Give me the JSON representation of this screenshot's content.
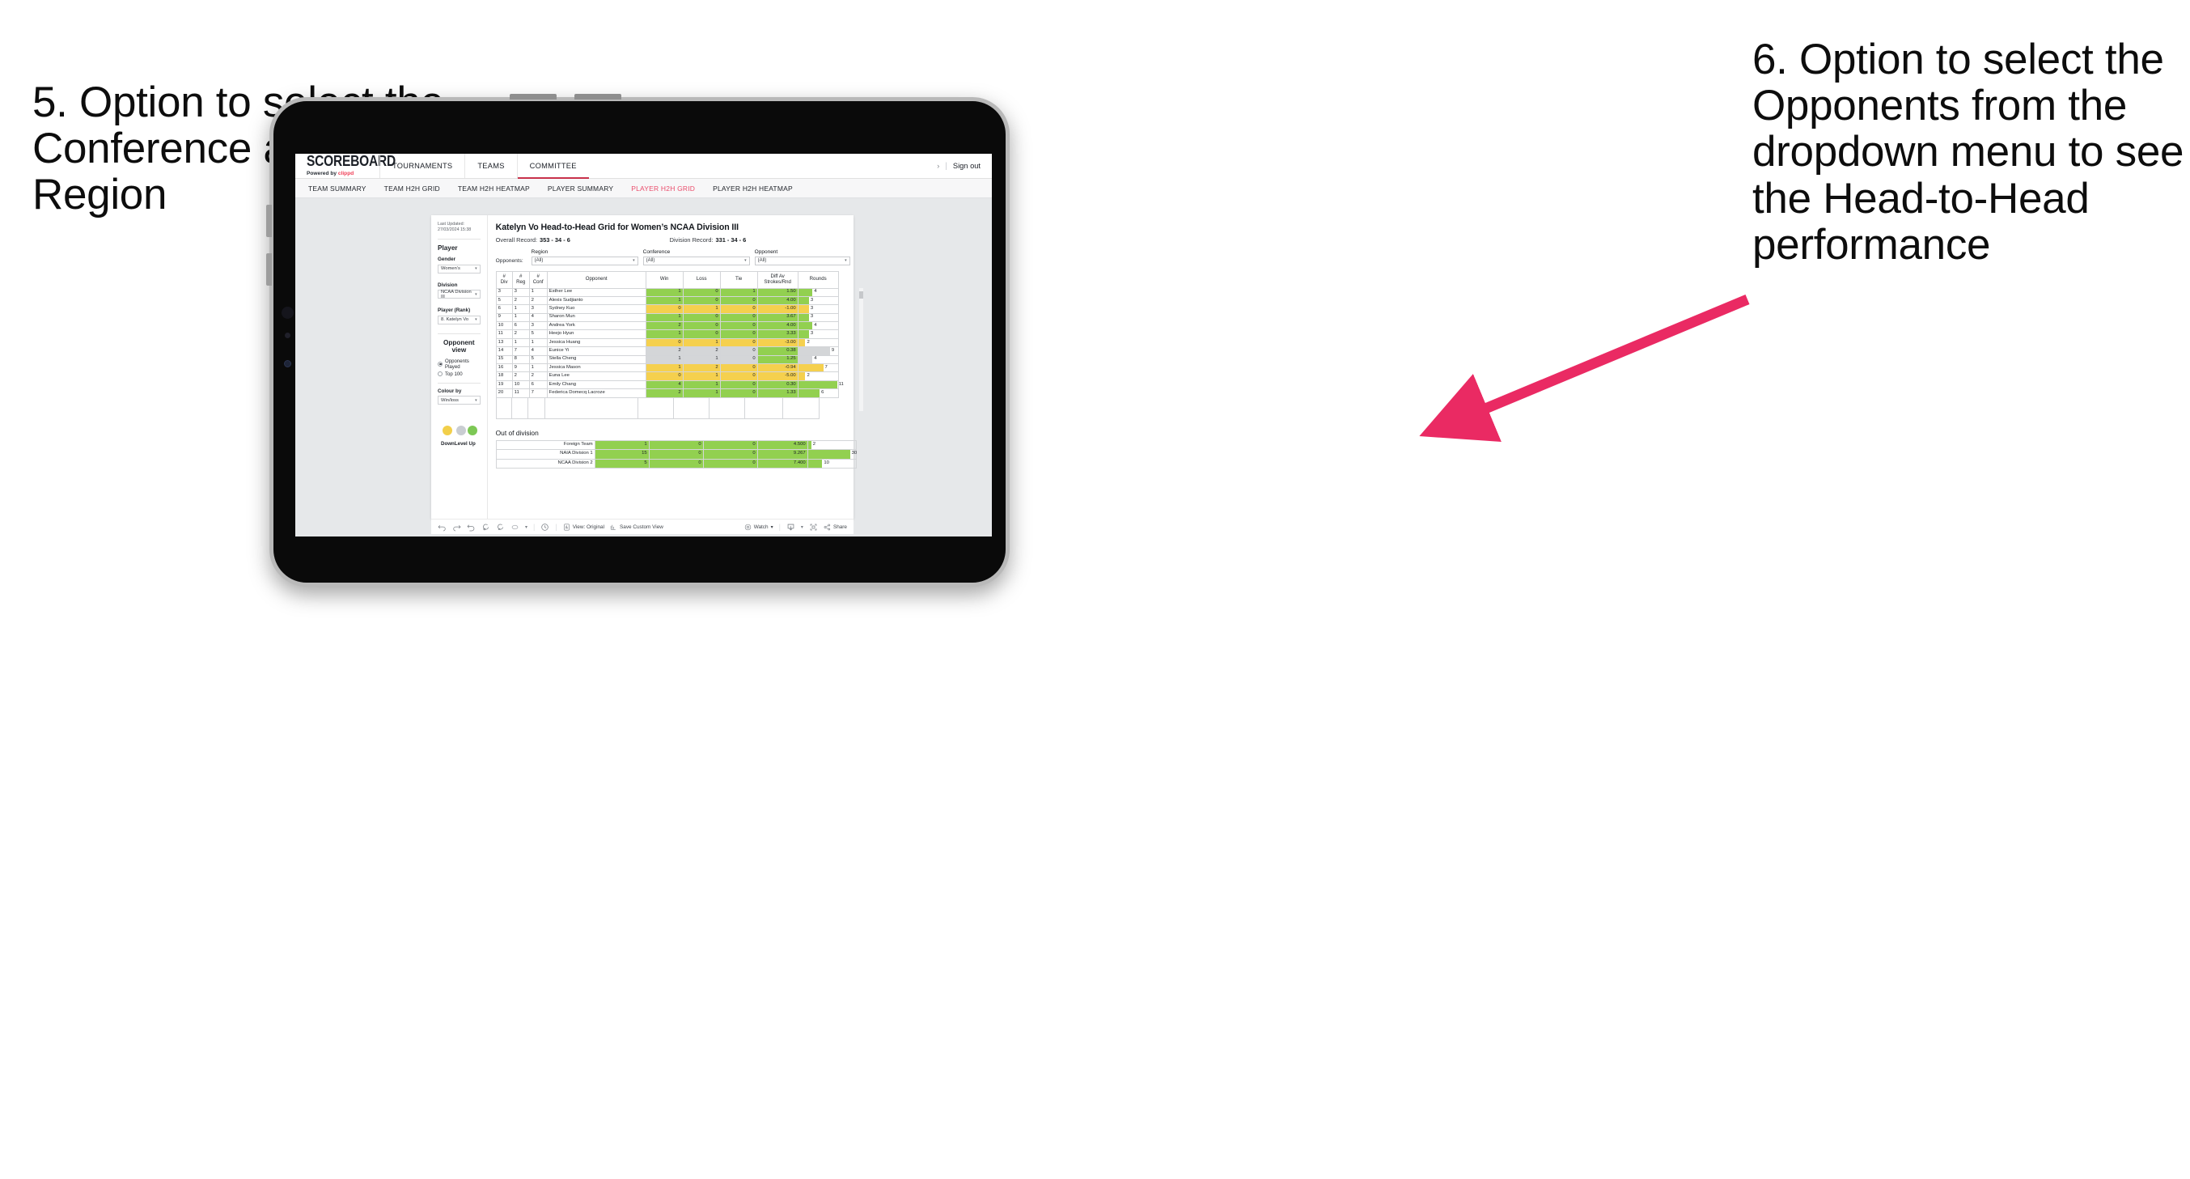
{
  "annotations": {
    "left": "5. Option to select the Conference and Region",
    "right": "6. Option to select the Opponents from the dropdown menu to see the Head-to-Head performance",
    "arrow_color": "#ea2a63"
  },
  "app": {
    "brand": {
      "title": "SCOREBOARD",
      "powered_prefix": "Powered by ",
      "powered_brand": "clippd"
    },
    "top_nav": [
      {
        "label": "TOURNAMENTS",
        "active": false
      },
      {
        "label": "TEAMS",
        "active": false
      },
      {
        "label": "COMMITTEE",
        "active": true
      }
    ],
    "header_right": {
      "chevron": "›",
      "divider": "|",
      "sign_out": "Sign out"
    },
    "sub_tabs": [
      {
        "label": "TEAM SUMMARY",
        "active": false
      },
      {
        "label": "TEAM H2H GRID",
        "active": false
      },
      {
        "label": "TEAM H2H HEATMAP",
        "active": false
      },
      {
        "label": "PLAYER SUMMARY",
        "active": false
      },
      {
        "label": "PLAYER H2H GRID",
        "active": true
      },
      {
        "label": "PLAYER H2H HEATMAP",
        "active": false
      }
    ]
  },
  "sidebar": {
    "last_updated": "Last Updated: 27/03/2024 15:38",
    "player_heading": "Player",
    "gender": {
      "label": "Gender",
      "value": "Women’s"
    },
    "division": {
      "label": "Division",
      "value": "NCAA Division III"
    },
    "player_rank": {
      "label": "Player (Rank)",
      "value": "8. Katelyn Vo"
    },
    "opponent_view": {
      "heading": "Opponent view",
      "options": [
        {
          "label": "Opponents Played",
          "selected": true
        },
        {
          "label": "Top 100",
          "selected": false
        }
      ]
    },
    "colour_by": {
      "label": "Colour by",
      "value": "Win/loss"
    },
    "legend": [
      {
        "caption": "Down",
        "color": "#f2cf4a"
      },
      {
        "caption": "Level",
        "color": "#c9cdd2"
      },
      {
        "caption": "Up",
        "color": "#7dc855"
      }
    ]
  },
  "viz": {
    "title": "Katelyn Vo Head-to-Head Grid for Women’s NCAA Division III",
    "overall_record": {
      "label": "Overall Record:",
      "value": "353 - 34 - 6"
    },
    "division_record": {
      "label": "Division Record:",
      "value": "331 - 34 - 6"
    },
    "filters": {
      "row_label": "Opponents:",
      "region": {
        "label": "Region",
        "value": "(All)"
      },
      "conference": {
        "label": "Conference",
        "value": "(All)"
      },
      "opponent": {
        "label": "Opponent",
        "value": "(All)"
      }
    }
  },
  "chart_data": {
    "type": "table",
    "title": "Katelyn Vo Head-to-Head Grid for Women’s NCAA Division III",
    "columns": [
      "# Div",
      "# Reg",
      "# Conf",
      "Opponent",
      "Win",
      "Loss",
      "Tie",
      "Diff Av Strokes/Rnd",
      "Rounds"
    ],
    "column_header_lines": [
      [
        "#",
        "Div"
      ],
      [
        "#",
        "Reg"
      ],
      [
        "#",
        "Conf"
      ],
      [
        "Opponent"
      ],
      [
        "Win"
      ],
      [
        "Loss"
      ],
      [
        "Tie"
      ],
      [
        "Diff Av",
        "Strokes/Rnd"
      ],
      [
        "Rounds"
      ]
    ],
    "rows": [
      {
        "div": "3",
        "reg": "3",
        "conf": "1",
        "opponent": "Esther Lee",
        "win": "1",
        "loss": "0",
        "tie": "1",
        "diff": "1.50",
        "rounds": "4",
        "state": "up",
        "bar_pct": 36
      },
      {
        "div": "5",
        "reg": "2",
        "conf": "2",
        "opponent": "Alexis Sudjianto",
        "win": "1",
        "loss": "0",
        "tie": "0",
        "diff": "4.00",
        "rounds": "3",
        "state": "up",
        "bar_pct": 27
      },
      {
        "div": "6",
        "reg": "1",
        "conf": "3",
        "opponent": "Sydney Kuo",
        "win": "0",
        "loss": "1",
        "tie": "0",
        "diff": "-1.00",
        "rounds": "3",
        "state": "down",
        "bar_pct": 27
      },
      {
        "div": "9",
        "reg": "1",
        "conf": "4",
        "opponent": "Sharon Mun",
        "win": "1",
        "loss": "0",
        "tie": "0",
        "diff": "3.67",
        "rounds": "3",
        "state": "up",
        "bar_pct": 27
      },
      {
        "div": "10",
        "reg": "6",
        "conf": "3",
        "opponent": "Andrea York",
        "win": "2",
        "loss": "0",
        "tie": "0",
        "diff": "4.00",
        "rounds": "4",
        "state": "up",
        "bar_pct": 36
      },
      {
        "div": "11",
        "reg": "2",
        "conf": "5",
        "opponent": "Heejo Hyun",
        "win": "1",
        "loss": "0",
        "tie": "0",
        "diff": "3.33",
        "rounds": "3",
        "state": "up",
        "bar_pct": 27
      },
      {
        "div": "13",
        "reg": "1",
        "conf": "1",
        "opponent": "Jessica Huang",
        "win": "0",
        "loss": "1",
        "tie": "0",
        "diff": "-3.00",
        "rounds": "2",
        "state": "down",
        "bar_pct": 18
      },
      {
        "div": "14",
        "reg": "7",
        "conf": "4",
        "opponent": "Eunice Yi",
        "win": "2",
        "loss": "2",
        "tie": "0",
        "diff": "0.38",
        "rounds": "9",
        "state": "level",
        "bar_pct": 80,
        "diff_state": "up"
      },
      {
        "div": "15",
        "reg": "8",
        "conf": "5",
        "opponent": "Stella Cheng",
        "win": "1",
        "loss": "1",
        "tie": "0",
        "diff": "1.25",
        "rounds": "4",
        "state": "level",
        "bar_pct": 36,
        "diff_state": "up"
      },
      {
        "div": "16",
        "reg": "9",
        "conf": "1",
        "opponent": "Jessica Mason",
        "win": "1",
        "loss": "2",
        "tie": "0",
        "diff": "-0.94",
        "rounds": "7",
        "state": "down",
        "bar_pct": 63
      },
      {
        "div": "18",
        "reg": "2",
        "conf": "2",
        "opponent": "Euna Lee",
        "win": "0",
        "loss": "1",
        "tie": "0",
        "diff": "-5.00",
        "rounds": "2",
        "state": "down",
        "bar_pct": 18
      },
      {
        "div": "19",
        "reg": "10",
        "conf": "6",
        "opponent": "Emily Chang",
        "win": "4",
        "loss": "1",
        "tie": "0",
        "diff": "0.30",
        "rounds": "11",
        "state": "up",
        "bar_pct": 98
      },
      {
        "div": "20",
        "reg": "11",
        "conf": "7",
        "opponent": "Federica Domecq Lacroze",
        "win": "2",
        "loss": "1",
        "tie": "0",
        "diff": "1.33",
        "rounds": "6",
        "state": "up",
        "bar_pct": 54
      }
    ],
    "out_of_division": {
      "title": "Out of division",
      "rows": [
        {
          "opponent": "Foreign Team",
          "win": "1",
          "loss": "0",
          "tie": "0",
          "diff": "4.500",
          "rounds": "2",
          "state": "up",
          "bar_pct": 7
        },
        {
          "opponent": "NAIA Division 1",
          "win": "15",
          "loss": "0",
          "tie": "0",
          "diff": "9.267",
          "rounds": "30",
          "state": "up",
          "bar_pct": 88
        },
        {
          "opponent": "NCAA Division 2",
          "win": "5",
          "loss": "0",
          "tie": "0",
          "diff": "7.400",
          "rounds": "10",
          "state": "up",
          "bar_pct": 30
        }
      ]
    },
    "colors": {
      "up": "#92d050",
      "down": "#f5d04e",
      "level": "#d4d6d8"
    }
  },
  "toolbar": {
    "view_label": "View: Original",
    "save_custom_view": "Save Custom View",
    "watch": "Watch",
    "share": "Share",
    "caret": "▾"
  }
}
